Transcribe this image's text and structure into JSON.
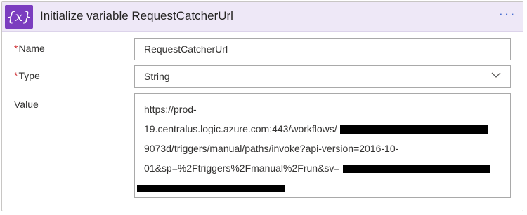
{
  "action": {
    "icon": "variable-icon",
    "icon_glyph": "{x}",
    "title": "Initialize variable RequestCatcherUrl",
    "more_glyph": "···",
    "accent_color": "#7b3dbf",
    "header_bg": "#eee8f7"
  },
  "fields": {
    "name": {
      "required_mark": "*",
      "label": "Name",
      "value": "RequestCatcherUrl"
    },
    "type": {
      "required_mark": "*",
      "label": "Type",
      "value": "String"
    },
    "value": {
      "label": "Value",
      "lines": [
        "https://prod-",
        "19.centralus.logic.azure.com:443/workflows/",
        "9073d/triggers/manual/paths/invoke?api-version=2016-10-",
        "01&sp=%2Ftriggers%2Fmanual%2Frun&sv=",
        ""
      ]
    }
  },
  "required_color": "#d13438"
}
